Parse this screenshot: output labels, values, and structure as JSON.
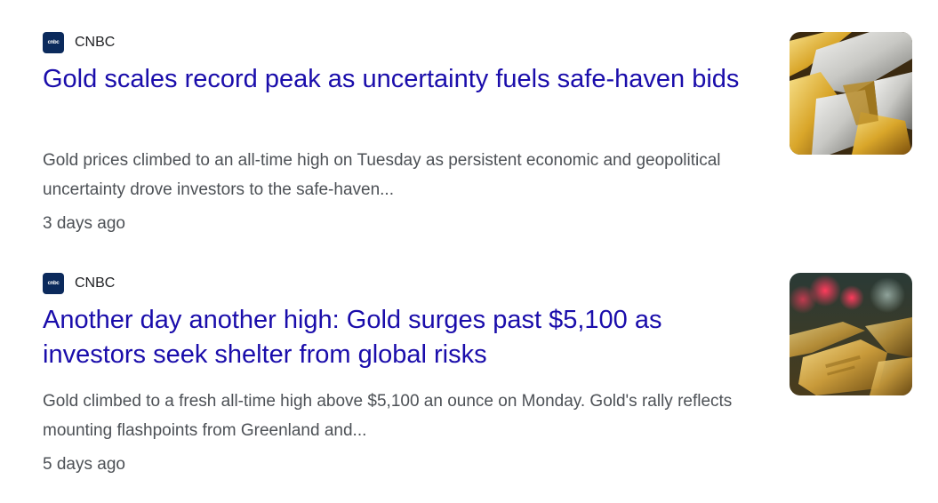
{
  "articles": [
    {
      "source": {
        "name": "CNBC",
        "logo_text": "cnbc",
        "logo_color": "#0b2a5c"
      },
      "headline": "Gold scales record peak as uncertainty fuels safe-haven bids",
      "snippet": "Gold prices climbed to an all-time high on Tuesday as persistent economic and geopolitical uncertainty drove investors to the safe-haven...",
      "time": "3 days ago",
      "thumbnail": "gold-and-silver-bars-image"
    },
    {
      "source": {
        "name": "CNBC",
        "logo_text": "cnbc",
        "logo_color": "#0b2a5c"
      },
      "headline": "Another day another high: Gold surges past $5,100 as investors seek shelter from global risks",
      "snippet": "Gold climbed to a fresh all-time high above $5,100 an ounce on Monday. Gold's rally reflects mounting flashpoints from Greenland and...",
      "time": "5 days ago",
      "thumbnail": "gold-bars-red-bokeh-image"
    }
  ],
  "colors": {
    "headline_link": "#1a0dab",
    "snippet_text": "#4d5156",
    "source_text": "#202124"
  }
}
